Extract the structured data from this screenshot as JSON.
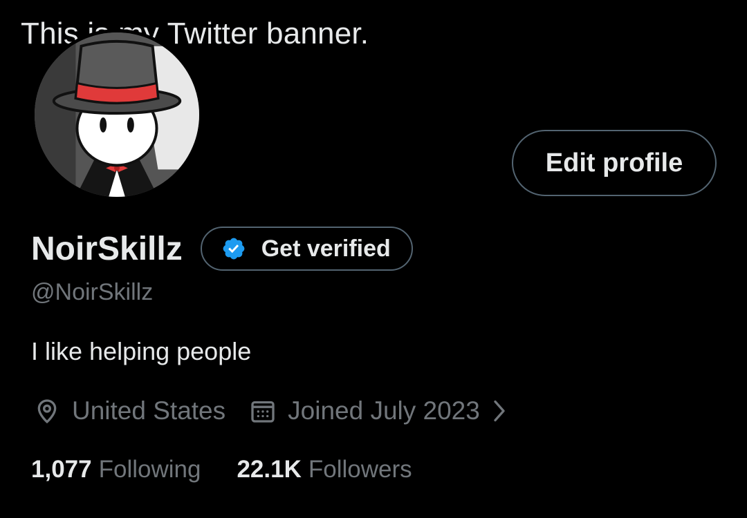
{
  "banner": {
    "text": "This is my Twitter banner."
  },
  "profile": {
    "display_name": "NoirSkillz",
    "handle": "@NoirSkillz",
    "bio": "I like helping people",
    "location": "United States",
    "joined": "Joined July 2023"
  },
  "actions": {
    "edit_profile_label": "Edit profile",
    "get_verified_label": "Get verified"
  },
  "stats": {
    "following_count": "1,077",
    "following_label": "Following",
    "followers_count": "22.1K",
    "followers_label": "Followers"
  },
  "icons": {
    "location": "location-pin-icon",
    "calendar": "calendar-icon",
    "verified": "verified-badge-icon",
    "chevron": "chevron-right-icon"
  },
  "colors": {
    "background": "#000000",
    "text_primary": "#e7e9ea",
    "text_secondary": "#71767b",
    "border": "#536471",
    "verified_blue": "#1d9bf0"
  }
}
